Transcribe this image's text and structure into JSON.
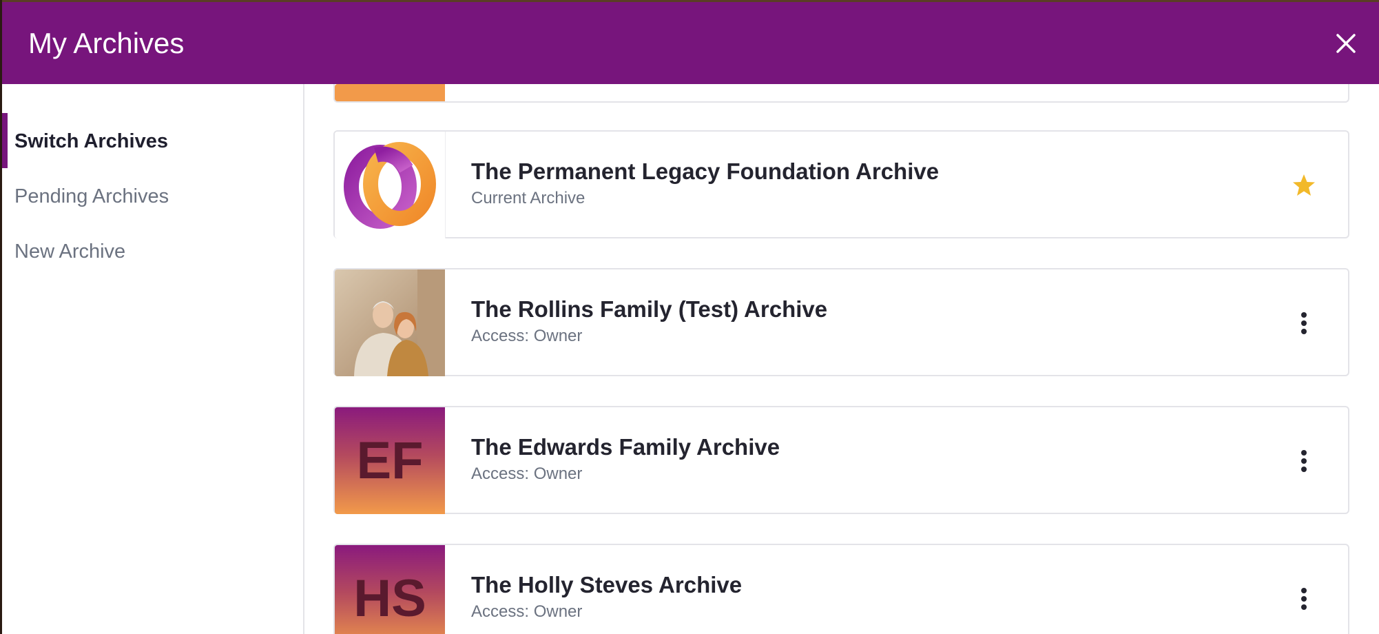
{
  "dialog": {
    "title": "My Archives",
    "close_icon": "close-icon"
  },
  "colors": {
    "header": "#77157c",
    "star": "#f2b92a",
    "accent_bar": "#77157c"
  },
  "sidebar": {
    "items": [
      {
        "label": "Switch Archives",
        "active": true
      },
      {
        "label": "Pending Archives",
        "active": false
      },
      {
        "label": "New Archive",
        "active": false
      }
    ]
  },
  "archives": [
    {
      "name": "The Permanent Legacy Foundation Archive",
      "subtitle": "Current Archive",
      "thumb": "permanent-logo",
      "action_icon": "star-icon"
    },
    {
      "name": "The Rollins Family (Test) Archive",
      "subtitle": "Access: Owner",
      "thumb": "photo",
      "action_icon": "more-vertical-icon"
    },
    {
      "name": "The Edwards Family Archive",
      "subtitle": "Access: Owner",
      "thumb": "initials",
      "initials": "EF",
      "action_icon": "more-vertical-icon"
    },
    {
      "name": "The Holly Steves Archive",
      "subtitle": "Access: Owner",
      "thumb": "initials",
      "initials": "HS",
      "action_icon": "more-vertical-icon"
    }
  ]
}
